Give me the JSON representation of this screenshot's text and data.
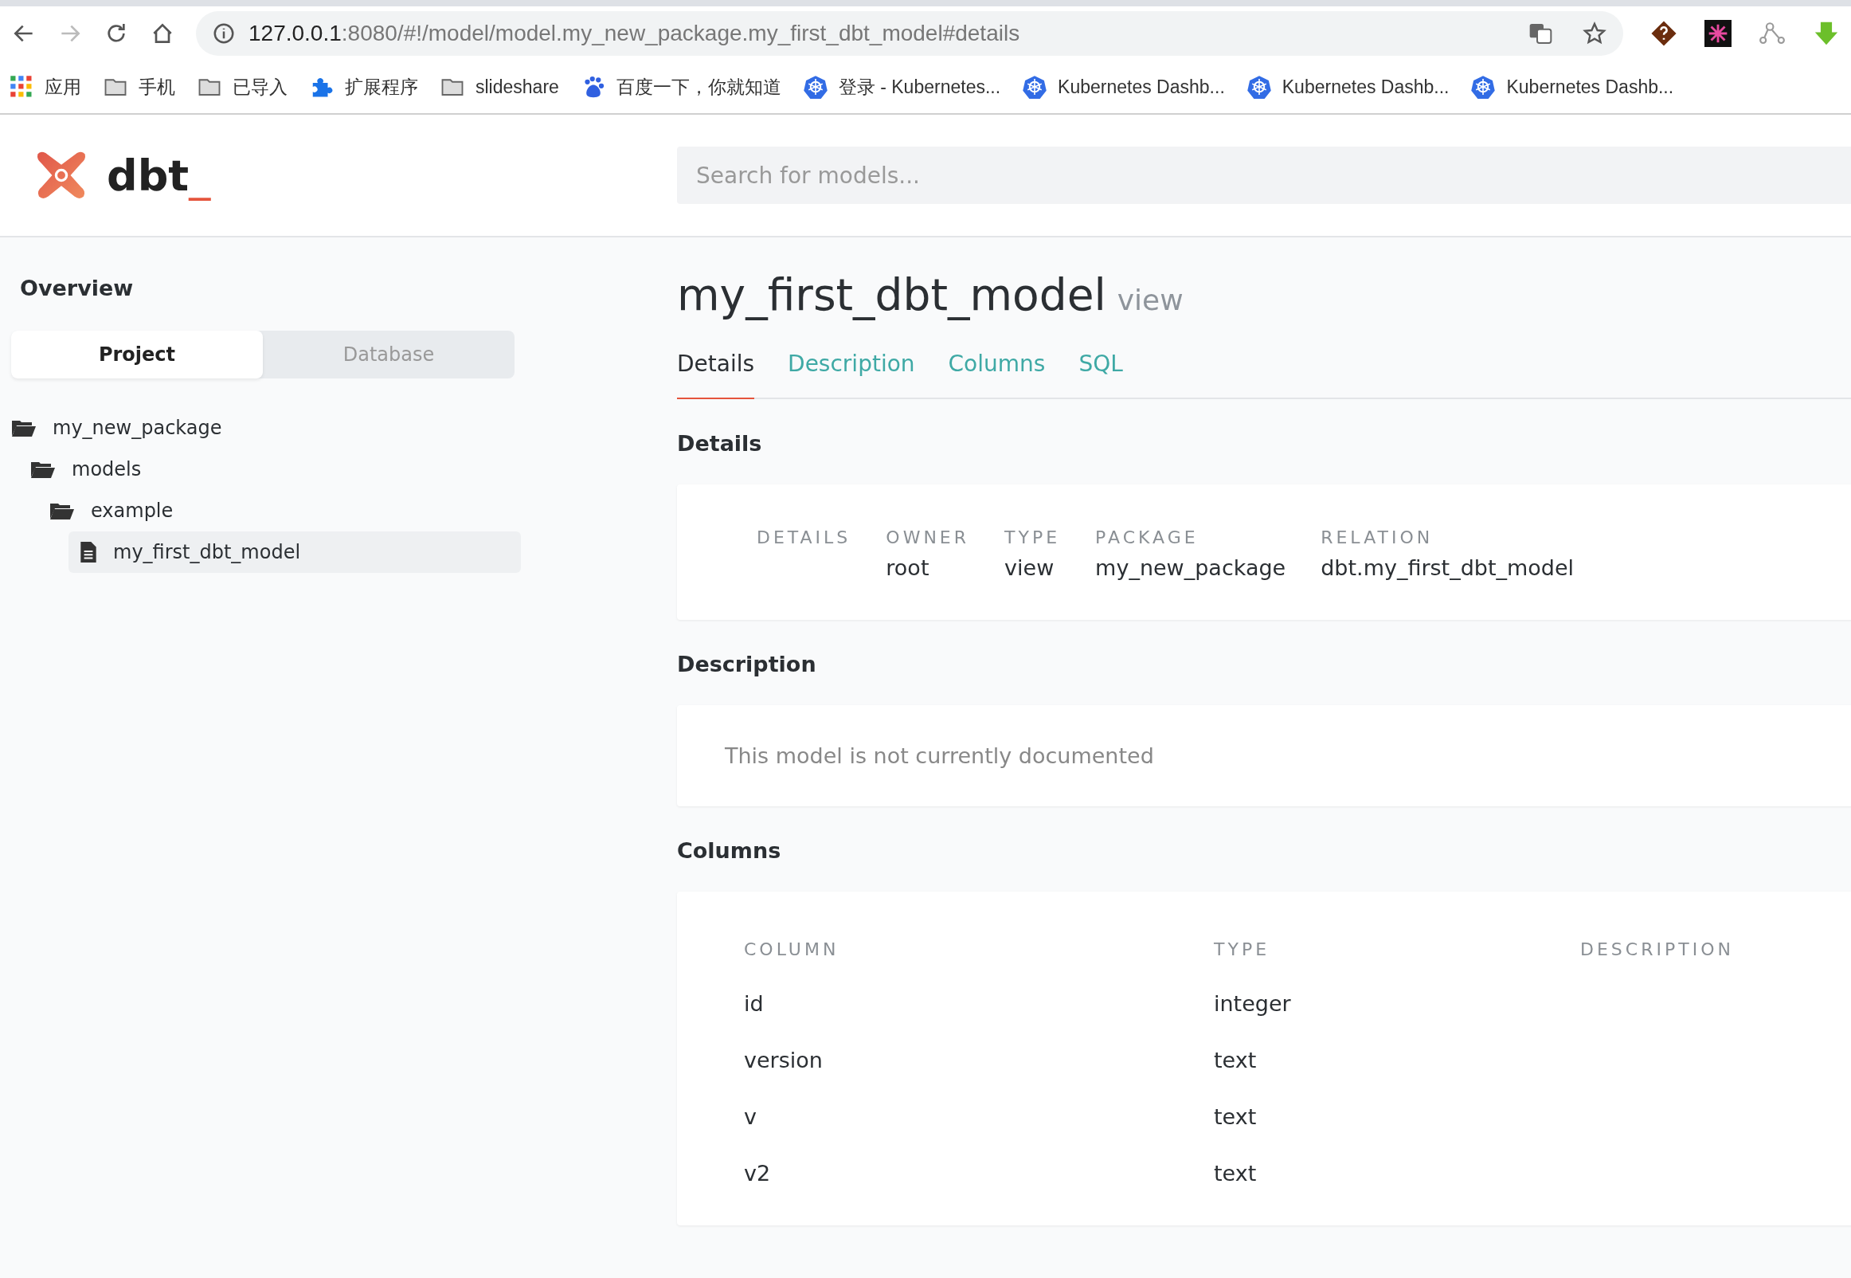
{
  "browser": {
    "url_host": "127.0.0.1",
    "url_rest": ":8080/#!/model/model.my_new_package.my_first_dbt_model#details",
    "bookmarks": [
      {
        "kind": "apps",
        "label": "应用"
      },
      {
        "kind": "folder",
        "label": "手机"
      },
      {
        "kind": "folder",
        "label": "已导入"
      },
      {
        "kind": "extension",
        "label": "扩展程序"
      },
      {
        "kind": "folder",
        "label": "slideshare"
      },
      {
        "kind": "baidu",
        "label": "百度一下，你就知道"
      },
      {
        "kind": "kubernetes",
        "label": "登录 - Kubernetes..."
      },
      {
        "kind": "kubernetes",
        "label": "Kubernetes Dashb..."
      },
      {
        "kind": "kubernetes",
        "label": "Kubernetes Dashb..."
      },
      {
        "kind": "kubernetes",
        "label": "Kubernetes Dashb..."
      }
    ]
  },
  "header": {
    "logo_text": "dbt",
    "logo_cursor": "_",
    "search": {
      "placeholder": "Search for models..."
    }
  },
  "sidebar": {
    "title": "Overview",
    "tabs": [
      {
        "label": "Project",
        "selected": true
      },
      {
        "label": "Database",
        "selected": false
      }
    ],
    "tree": [
      {
        "kind": "folder",
        "name": "my_new_package",
        "expanded": true,
        "selected": false,
        "children": [
          {
            "kind": "folder",
            "name": "models",
            "expanded": true,
            "selected": false,
            "children": [
              {
                "kind": "folder",
                "name": "example",
                "expanded": true,
                "selected": false,
                "children": [
                  {
                    "kind": "file",
                    "name": "my_first_dbt_model",
                    "selected": true
                  }
                ]
              }
            ]
          }
        ]
      }
    ]
  },
  "main": {
    "title": "my_first_dbt_model",
    "subtitle": "view",
    "tabs": [
      {
        "label": "Details",
        "selected": true
      },
      {
        "label": "Description",
        "selected": false
      },
      {
        "label": "Columns",
        "selected": false
      },
      {
        "label": "SQL",
        "selected": false
      }
    ],
    "details": {
      "heading": "Details",
      "fields": [
        {
          "label": "DETAILS"
        },
        {
          "label": "OWNER",
          "value": "root"
        },
        {
          "label": "TYPE",
          "value": "view"
        },
        {
          "label": "PACKAGE",
          "value": "my_new_package"
        },
        {
          "label": "RELATION",
          "value": "dbt.my_first_dbt_model"
        }
      ]
    },
    "description": {
      "heading": "Description",
      "text": "This model is not currently documented"
    },
    "columns": {
      "heading": "Columns",
      "headers": [
        "COLUMN",
        "TYPE",
        "DESCRIPTION"
      ],
      "rows": [
        {
          "name": "id",
          "type": "integer"
        },
        {
          "name": "version",
          "type": "text"
        },
        {
          "name": "v",
          "type": "text"
        },
        {
          "name": "v2",
          "type": "text"
        }
      ]
    }
  }
}
